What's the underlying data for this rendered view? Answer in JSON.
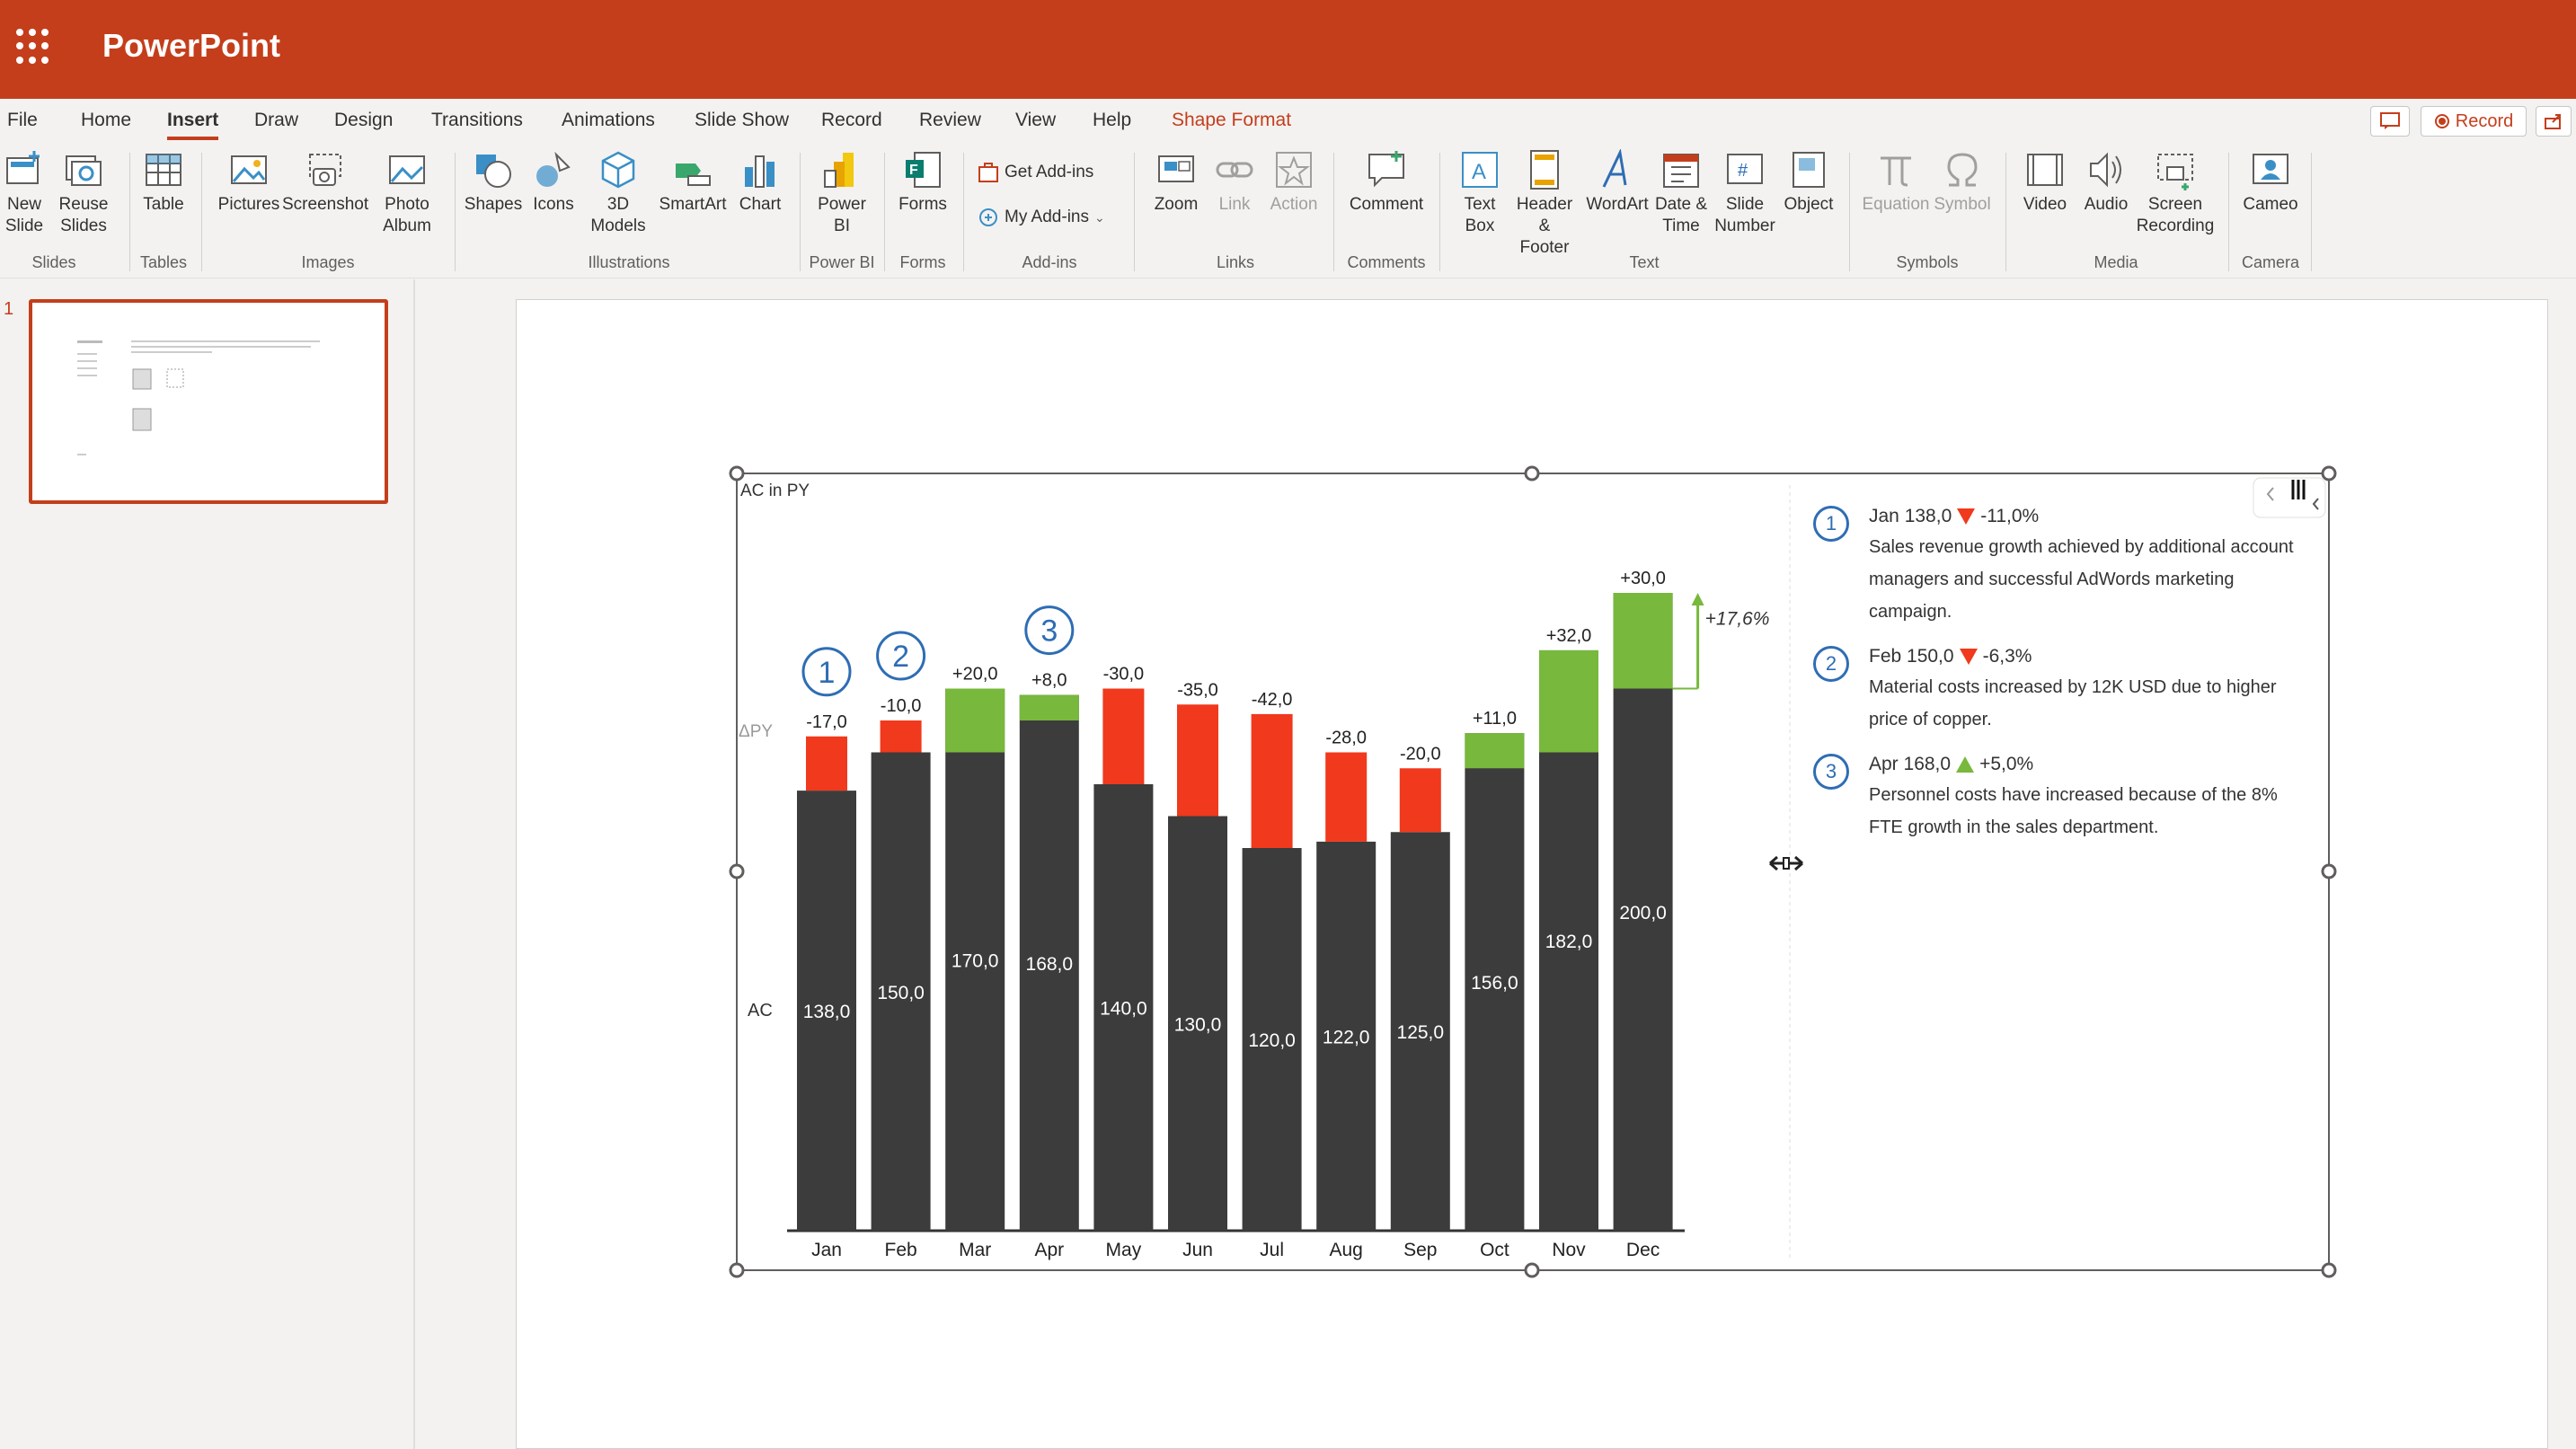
{
  "app": {
    "name": "PowerPoint"
  },
  "tabs": [
    "File",
    "Home",
    "Insert",
    "Draw",
    "Design",
    "Transitions",
    "Animations",
    "Slide Show",
    "Record",
    "Review",
    "View",
    "Help",
    "Shape Format"
  ],
  "active_tab": "Insert",
  "top_right": {
    "record": "Record"
  },
  "ribbon": {
    "new_slide": "New Slide",
    "reuse_slides": "Reuse Slides",
    "table": "Table",
    "pictures": "Pictures",
    "screenshot": "Screenshot",
    "photo_album": "Photo Album",
    "shapes": "Shapes",
    "icons": "Icons",
    "models_3d": "3D Models",
    "smartart": "SmartArt",
    "chart": "Chart",
    "power_bi": "Power BI",
    "forms": "Forms",
    "get_addins": "Get Add-ins",
    "my_addins": "My Add-ins",
    "zoom": "Zoom",
    "link": "Link",
    "action": "Action",
    "comment": "Comment",
    "text_box": "Text Box",
    "header_footer": "Header & Footer",
    "wordart": "WordArt",
    "date_time": "Date & Time",
    "slide_number": "Slide Number",
    "object": "Object",
    "equation": "Equation",
    "symbol": "Symbol",
    "video": "Video",
    "audio": "Audio",
    "screen_recording": "Screen Recording",
    "cameo": "Cameo",
    "groups": {
      "slides": "Slides",
      "tables": "Tables",
      "images": "Images",
      "illustrations": "Illustrations",
      "power_bi": "Power BI",
      "forms": "Forms",
      "addins": "Add-ins",
      "links": "Links",
      "comments": "Comments",
      "text": "Text",
      "symbols": "Symbols",
      "media": "Media",
      "camera": "Camera"
    }
  },
  "thumbnail": {
    "number": "1"
  },
  "colors": {
    "accent": "#c43e1c",
    "bar": "#3c3c3c",
    "negative": "#f0391d",
    "positive": "#78b83c",
    "marker": "#2e6db4"
  },
  "chart_data": {
    "type": "bar",
    "title": "AC in PY",
    "row_labels": {
      "delta": "ΔPY",
      "ac": "AC"
    },
    "categories": [
      "Jan",
      "Feb",
      "Mar",
      "Apr",
      "May",
      "Jun",
      "Jul",
      "Aug",
      "Sep",
      "Oct",
      "Nov",
      "Dec"
    ],
    "series": [
      {
        "name": "AC",
        "values": [
          138.0,
          150.0,
          170.0,
          168.0,
          140.0,
          130.0,
          120.0,
          122.0,
          125.0,
          156.0,
          182.0,
          200.0
        ],
        "labels": [
          "138,0",
          "150,0",
          "170,0",
          "168,0",
          "140,0",
          "130,0",
          "120,0",
          "122,0",
          "125,0",
          "156,0",
          "182,0",
          "200,0"
        ]
      },
      {
        "name": "ΔPY",
        "values": [
          -17.0,
          -10.0,
          20.0,
          8.0,
          -30.0,
          -35.0,
          -42.0,
          -28.0,
          -20.0,
          11.0,
          32.0,
          30.0
        ],
        "labels": [
          "-17,0",
          "-10,0",
          "+20,0",
          "+8,0",
          "-30,0",
          "-35,0",
          "-42,0",
          "-28,0",
          "-20,0",
          "+11,0",
          "+32,0",
          "+30,0"
        ]
      }
    ],
    "callout_markers": [
      {
        "index": 0,
        "label": "1"
      },
      {
        "index": 1,
        "label": "2"
      },
      {
        "index": 3,
        "label": "3"
      }
    ],
    "dec_growth_label": "+17,6%"
  },
  "notes": [
    {
      "num": "1",
      "head_value": "Jan 138,0",
      "direction": "down",
      "head_pct": "-11,0%",
      "text": "Sales revenue growth achieved by additional account managers and successful AdWords marketing campaign."
    },
    {
      "num": "2",
      "head_value": "Feb 150,0",
      "direction": "down",
      "head_pct": "-6,3%",
      "text": "Material costs increased by 12K USD due to higher price of copper."
    },
    {
      "num": "3",
      "head_value": "Apr 168,0",
      "direction": "up",
      "head_pct": "+5,0%",
      "text": "Personnel costs have increased because of the 8% FTE growth in the sales department."
    }
  ]
}
